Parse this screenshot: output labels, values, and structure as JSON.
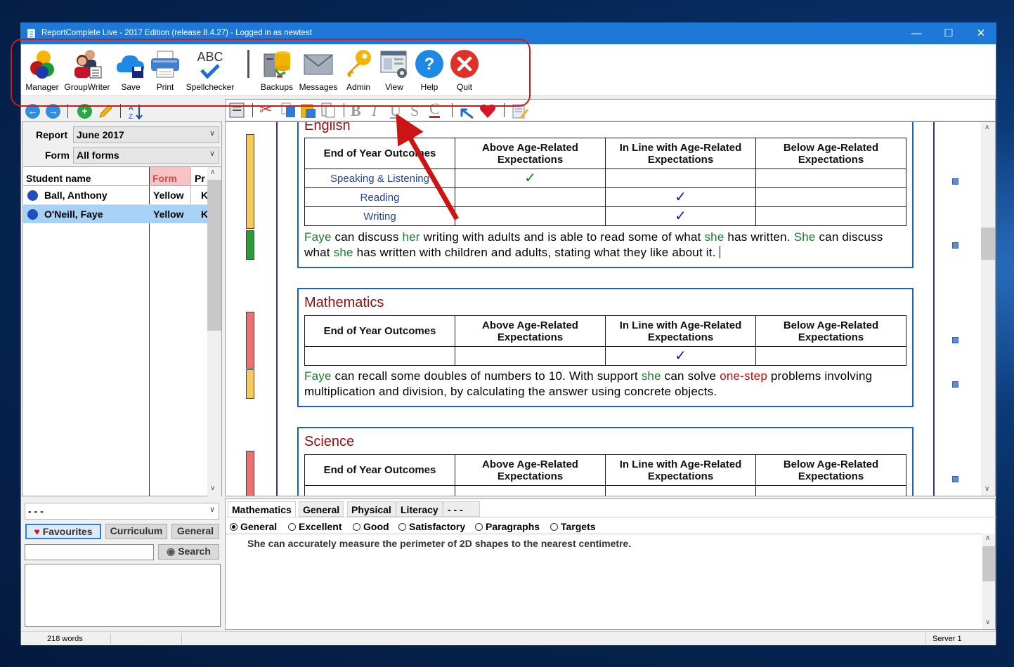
{
  "window": {
    "title": "ReportComplete Live - 2017 Edition (release 8.4.27) - Logged in as newtest",
    "controls": {
      "minimize": "—",
      "maximize": "☐",
      "close": "✕"
    }
  },
  "toolbar": {
    "manager": "Manager",
    "groupwriter": "GroupWriter",
    "save": "Save",
    "print": "Print",
    "spellchecker": "Spellchecker",
    "spell_abc": "ABC",
    "backups": "Backups",
    "messages": "Messages",
    "admin": "Admin",
    "view": "View",
    "help": "Help",
    "quit": "Quit"
  },
  "left_panel": {
    "report_label": "Report",
    "report_value": "June 2017",
    "form_label": "Form",
    "form_value": "All forms",
    "columns": [
      "Student name",
      "Form",
      "Pr"
    ],
    "students": [
      {
        "name": "Ball, Anthony",
        "form": "Yellow",
        "pr": "K",
        "selected": false
      },
      {
        "name": "O'Neill, Faye",
        "form": "Yellow",
        "pr": "K",
        "selected": true
      }
    ]
  },
  "format_toolbar": {
    "bold": "B",
    "italic": "I",
    "underline": "U",
    "strike": "S",
    "color": "C"
  },
  "document": {
    "table_headers": [
      "End of Year Outcomes",
      "Above Age-Related Expectations",
      "In Line with Age-Related Expectations",
      "Below Age-Related Expectations"
    ],
    "tick": "✓",
    "english": {
      "title": "English",
      "rows": [
        {
          "label": "Speaking & Listening",
          "above": true,
          "inline": false
        },
        {
          "label": "Reading",
          "above": false,
          "inline": true
        },
        {
          "label": "Writing",
          "above": false,
          "inline": true
        }
      ],
      "text": {
        "w1": "Faye",
        "t1": " can discuss ",
        "w2": "her",
        "t2": " writing with adults and is able to read some of what ",
        "w3": "she",
        "t3": " has written.  ",
        "w4": "She",
        "t4": " can discuss what ",
        "w5": "she",
        "t5": " has written with children and adults, stating what they like about it. "
      }
    },
    "mathematics": {
      "title": "Mathematics",
      "text": {
        "w1": "Faye",
        "t1": " can recall some doubles of numbers to 10.  With support ",
        "w2": "she",
        "t2": " can solve ",
        "w3": "one-step",
        "t3": " problems involving multiplication and division, by calculating the answer using concrete objects."
      }
    },
    "science": {
      "title": "Science"
    }
  },
  "bottom_left": {
    "dropdown_value": "- - -",
    "favourites": "Favourites",
    "curriculum": "Curriculum",
    "general": "General",
    "search_value": "",
    "search_button": "Search"
  },
  "bottom_right": {
    "tabs": [
      "Mathematics",
      "General",
      "Physical",
      "Literacy",
      "- - -"
    ],
    "active_tab": "Mathematics",
    "radios": [
      "General",
      "Excellent",
      "Good",
      "Satisfactory",
      "Paragraphs",
      "Targets"
    ],
    "selected_radio": "General",
    "comment": "She can accurately measure the perimeter of 2D shapes to the nearest centimetre."
  },
  "status": {
    "words": "218 words",
    "server": "Server 1"
  },
  "colors": {
    "title_bar": "#1e78d7",
    "annotation": "#d01818",
    "section_border": "#1c63a8",
    "section_title": "#8b1010",
    "pronoun_green": "#1e7a2a",
    "highlight_red": "#b01010",
    "selected_row": "#a8d2f5"
  },
  "icons": [
    "manager-icon",
    "groupwriter-icon",
    "save-icon",
    "print-icon",
    "spellchecker-icon",
    "backups-icon",
    "messages-icon",
    "admin-icon",
    "view-icon",
    "help-icon",
    "quit-icon",
    "back-icon",
    "forward-icon",
    "add-icon",
    "edit-icon",
    "sort-icon",
    "cut-icon",
    "copy-icon",
    "paste-icon",
    "heart-icon",
    "search-icon"
  ]
}
